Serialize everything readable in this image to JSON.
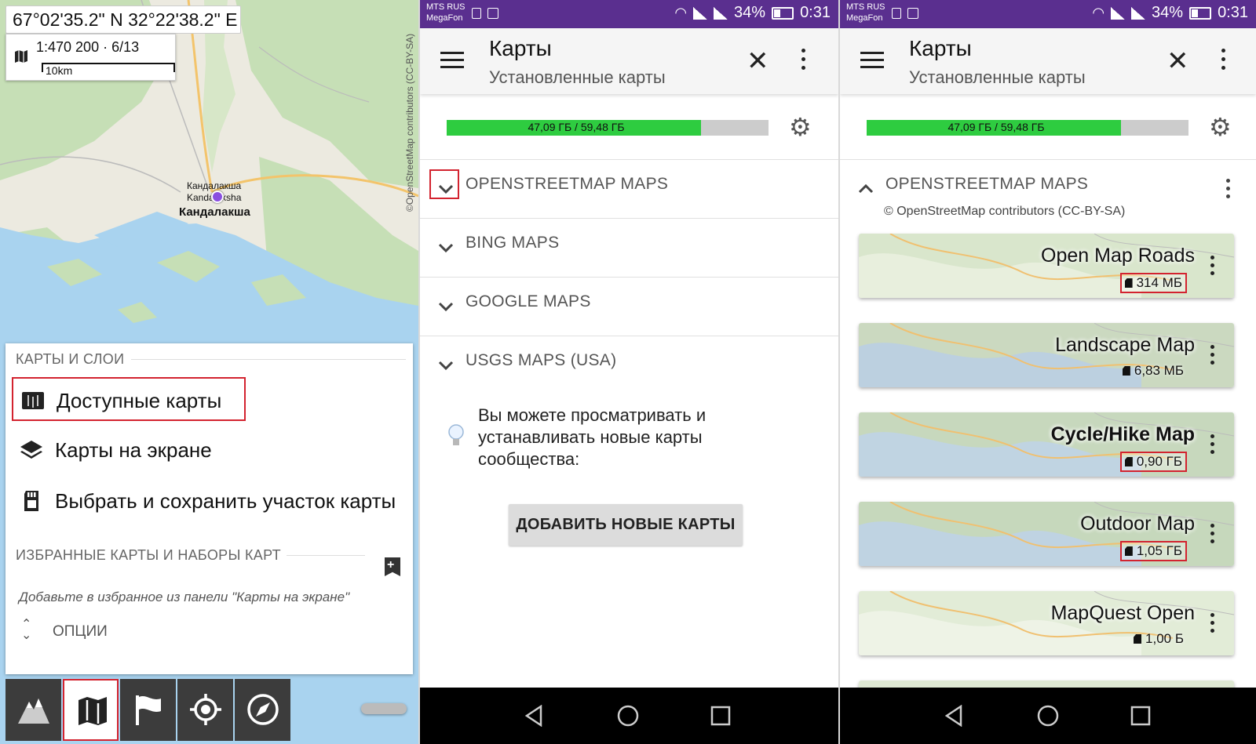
{
  "map_panel": {
    "coordinates": "67°02'35.2\" N 32°22'38.2\" E",
    "scale_text": "1:470 200 · 6/13",
    "scale_bar_label": "10km",
    "attribution": "©OpenStreetMap contributors (CC-BY-SA)",
    "town_label_1": "Кандалакша",
    "town_label_2": "Kandalaksha",
    "town_label_main": "Кандалакша",
    "sheet": {
      "section_maps": "КАРТЫ И СЛОИ",
      "items": [
        {
          "label": "Доступные карты",
          "icon": "map-book-icon"
        },
        {
          "label": "Карты на экране",
          "icon": "layers-icon"
        },
        {
          "label": "Выбрать и сохранить участок карты",
          "icon": "sd-card-icon"
        }
      ],
      "section_favorites": "ИЗБРАННЫЕ КАРТЫ И НАБОРЫ КАРТ",
      "favorites_hint": "Добавьте в избранное из панели \"Карты на экране\"",
      "options_label": "ОПЦИИ"
    },
    "toolbar": [
      "mountains-icon",
      "map-icon",
      "flag-icon",
      "locate-icon",
      "compass-icon"
    ]
  },
  "status_bar": {
    "carrier_1": "MTS RUS",
    "carrier_2": "MegaFon",
    "battery": "34%",
    "time": "0:31"
  },
  "header": {
    "title": "Карты",
    "subtitle": "Установленные карты"
  },
  "storage": {
    "text": "47,09 ГБ / 59,48 ГБ",
    "used_fraction": 0.79
  },
  "providers": [
    {
      "name": "OPENSTREETMAP MAPS"
    },
    {
      "name": "BING MAPS"
    },
    {
      "name": "GOOGLE MAPS"
    },
    {
      "name": "USGS MAPS (USA)"
    }
  ],
  "community_tip": "Вы можете просматривать и устанавливать новые карты сообщества:",
  "add_button": "ДОБАВИТЬ НОВЫЕ КАРТЫ",
  "installed": {
    "provider": "OPENSTREETMAP MAPS",
    "attribution": "© OpenStreetMap contributors (CC-BY-SA)",
    "maps": [
      {
        "name": "Open Map Roads",
        "size": "314 МБ",
        "highlighted": true
      },
      {
        "name": "Landscape Map",
        "size": "6,83 МБ",
        "highlighted": false
      },
      {
        "name": "Cycle/Hike Map",
        "size": "0,90 ГБ",
        "highlighted": true
      },
      {
        "name": "Outdoor Map",
        "size": "1,05 ГБ",
        "highlighted": true
      },
      {
        "name": "MapQuest Open",
        "size": "1,00 Б",
        "highlighted": false
      }
    ]
  },
  "colors": {
    "accent_highlight": "#d3232f",
    "status_bar": "#5a2f8f",
    "storage_fill": "#2ecc40"
  }
}
